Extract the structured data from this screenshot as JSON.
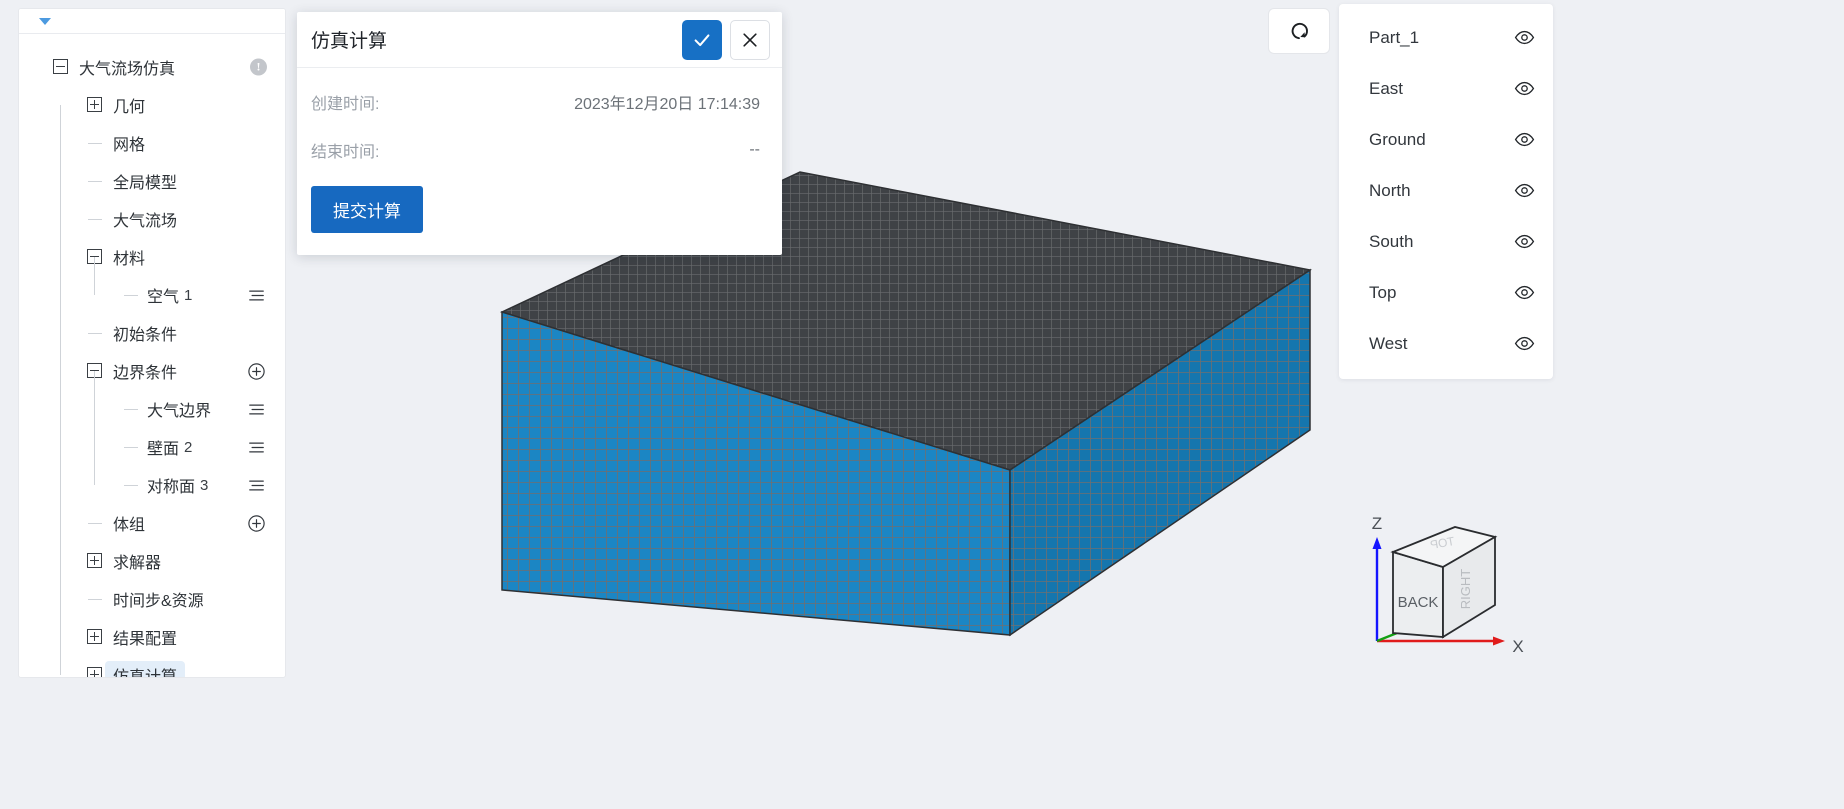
{
  "sidebar": {
    "tree": [
      {
        "id": "root",
        "label": "大气流场仿真",
        "sub": "",
        "depth": 0,
        "toggle": "minus",
        "action": "warn",
        "selected": false
      },
      {
        "id": "geometry",
        "label": "几何",
        "sub": "",
        "depth": 1,
        "toggle": "plus",
        "action": "none",
        "selected": false
      },
      {
        "id": "mesh",
        "label": "网格",
        "sub": "",
        "depth": 1,
        "toggle": "leaf",
        "action": "none",
        "selected": false
      },
      {
        "id": "global-model",
        "label": "全局模型",
        "sub": "",
        "depth": 1,
        "toggle": "leaf",
        "action": "none",
        "selected": false
      },
      {
        "id": "flow-field",
        "label": "大气流场",
        "sub": "",
        "depth": 1,
        "toggle": "leaf",
        "action": "none",
        "selected": false
      },
      {
        "id": "material",
        "label": "材料",
        "sub": "",
        "depth": 1,
        "toggle": "minus",
        "action": "none",
        "selected": false
      },
      {
        "id": "air-1",
        "label": "空气",
        "sub": "1",
        "depth": 2,
        "toggle": "leaf",
        "action": "menu",
        "selected": false
      },
      {
        "id": "initial-cond",
        "label": "初始条件",
        "sub": "",
        "depth": 1,
        "toggle": "leaf",
        "action": "none",
        "selected": false
      },
      {
        "id": "boundary",
        "label": "边界条件",
        "sub": "",
        "depth": 1,
        "toggle": "minus",
        "action": "add",
        "selected": false
      },
      {
        "id": "atmo-bound",
        "label": "大气边界",
        "sub": "",
        "depth": 2,
        "toggle": "leaf",
        "action": "menu",
        "selected": false
      },
      {
        "id": "wall-2",
        "label": "壁面",
        "sub": "2",
        "depth": 2,
        "toggle": "leaf",
        "action": "menu",
        "selected": false
      },
      {
        "id": "symmetry-3",
        "label": "对称面",
        "sub": "3",
        "depth": 2,
        "toggle": "leaf",
        "action": "menu",
        "selected": false
      },
      {
        "id": "volume-group",
        "label": "体组",
        "sub": "",
        "depth": 1,
        "toggle": "leaf",
        "action": "add",
        "selected": false
      },
      {
        "id": "solver",
        "label": "求解器",
        "sub": "",
        "depth": 1,
        "toggle": "plus",
        "action": "none",
        "selected": false
      },
      {
        "id": "timestep",
        "label": "时间步&资源",
        "sub": "",
        "depth": 1,
        "toggle": "leaf",
        "action": "none",
        "selected": false
      },
      {
        "id": "result-cfg",
        "label": "结果配置",
        "sub": "",
        "depth": 1,
        "toggle": "plus",
        "action": "none",
        "selected": false
      },
      {
        "id": "simulation",
        "label": "仿真计算",
        "sub": "",
        "depth": 1,
        "toggle": "plus",
        "action": "none",
        "selected": true
      }
    ]
  },
  "dialog": {
    "title": "仿真计算",
    "confirm_icon": "check-icon",
    "cancel_icon": "close-icon",
    "fields": [
      {
        "label": "创建时间:",
        "value": "2023年12月20日 17:14:39"
      },
      {
        "label": "结束时间:",
        "value": "--"
      }
    ],
    "submit_label": "提交计算"
  },
  "toolbar": {
    "reset_view_icon": "reset-view-icon"
  },
  "parts_panel": {
    "items": [
      {
        "name": "Part_1",
        "visible": true
      },
      {
        "name": "East",
        "visible": true
      },
      {
        "name": "Ground",
        "visible": true
      },
      {
        "name": "North",
        "visible": true
      },
      {
        "name": "South",
        "visible": true
      },
      {
        "name": "Top",
        "visible": true
      },
      {
        "name": "West",
        "visible": true
      }
    ],
    "eye_icon": "eye-icon"
  },
  "nav_cube": {
    "front_face": "BACK",
    "right_face": "RIGHT",
    "top_face": "TOP",
    "axis_z": "Z",
    "axis_x": "X"
  },
  "viewport": {
    "mesh_face_color": "#1b86c4",
    "mesh_top_color": "#3f4246",
    "mesh_wire_color": "#6f6f70",
    "background": "#eef0f4"
  },
  "colors": {
    "accent": "#1769c0",
    "selected_row": "#e3eef9",
    "axis_z": "#1414ff",
    "axis_x": "#e01b1b",
    "axis_y": "#13a013"
  }
}
